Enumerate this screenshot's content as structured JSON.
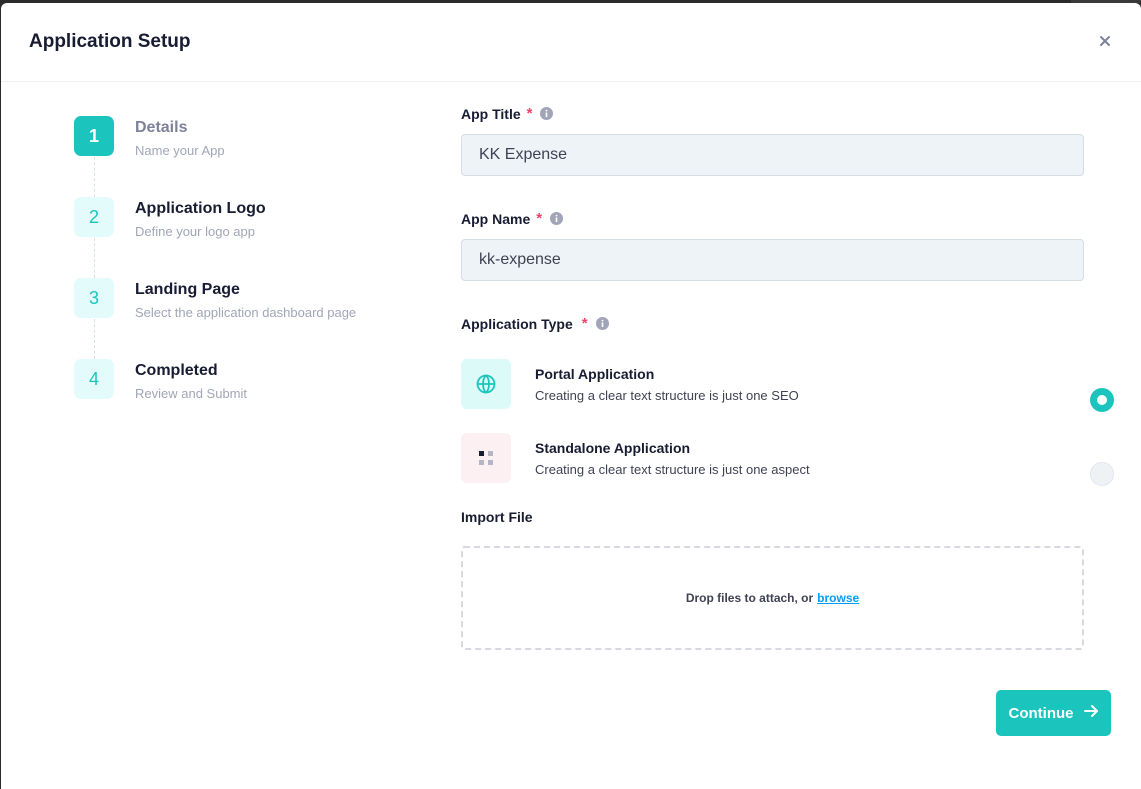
{
  "modal": {
    "title": "Application Setup",
    "close_icon": "close-icon"
  },
  "stepper": {
    "steps": [
      {
        "number": "1",
        "title": "Details",
        "desc": "Name your App",
        "active": true
      },
      {
        "number": "2",
        "title": "Application Logo",
        "desc": "Define your logo app",
        "active": false
      },
      {
        "number": "3",
        "title": "Landing Page",
        "desc": "Select the application dashboard page",
        "active": false
      },
      {
        "number": "4",
        "title": "Completed",
        "desc": "Review and Submit",
        "active": false
      }
    ]
  },
  "form": {
    "app_title": {
      "label": "App Title",
      "required": "*",
      "value": "KK Expense"
    },
    "app_name": {
      "label": "App Name",
      "required": "*",
      "value": "kk-expense"
    },
    "app_type": {
      "label": "Application Type",
      "required": "*",
      "options": [
        {
          "title": "Portal Application",
          "desc": "Creating a clear text structure is just one SEO",
          "icon": "globe-icon",
          "selected": true
        },
        {
          "title": "Standalone Application",
          "desc": "Creating a clear text structure is just one aspect",
          "icon": "grid-icon",
          "selected": false
        }
      ]
    },
    "import_file": {
      "label": "Import File",
      "drop_text": "Drop files to attach, or",
      "browse_text": "browse"
    },
    "continue_label": "Continue"
  },
  "colors": {
    "accent": "#1bc5bd",
    "accent_light": "#e4fbfb",
    "required": "#f1416c",
    "link": "#009ef7",
    "input_bg": "#eef3f7"
  }
}
